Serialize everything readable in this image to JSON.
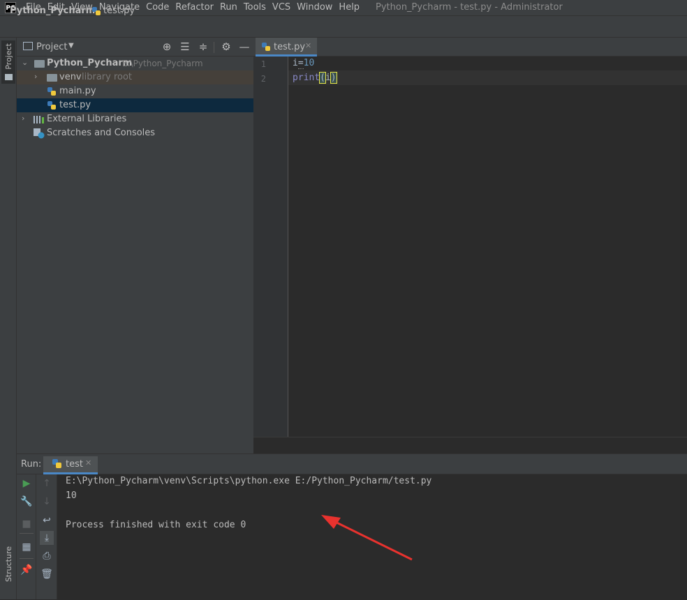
{
  "app": {
    "logo_text": "PC",
    "window_title": "Python_Pycharm - test.py - Administrator"
  },
  "menu": [
    "File",
    "Edit",
    "View",
    "Navigate",
    "Code",
    "Refactor",
    "Run",
    "Tools",
    "VCS",
    "Window",
    "Help"
  ],
  "breadcrumb": {
    "project": "Python_Pycharm",
    "file": "test.py"
  },
  "left_stripe": {
    "project": "Project",
    "structure": "Structure"
  },
  "project_panel": {
    "title": "Project",
    "tree": [
      {
        "label": "Python_Pycharm",
        "hint": "E:\\Python_Pycharm"
      },
      {
        "label": "venv",
        "hint": "library root"
      },
      {
        "label": "main.py"
      },
      {
        "label": "test.py"
      },
      {
        "label": "External Libraries"
      },
      {
        "label": "Scratches and Consoles"
      }
    ]
  },
  "editor": {
    "tab": "test.py",
    "line_numbers": [
      "1",
      "2"
    ],
    "code": {
      "l1_var": "i",
      "l1_op": "=",
      "l1_num": "10",
      "l2_fn": "print",
      "l2_open": "(",
      "l2_arg": "i",
      "l2_close": ")"
    }
  },
  "run_panel": {
    "label": "Run:",
    "tab": "test",
    "output": [
      "E:\\Python_Pycharm\\venv\\Scripts\\python.exe E:/Python_Pycharm/test.py",
      "10",
      "",
      "Process finished with exit code 0"
    ]
  },
  "colors": {
    "accent": "#4a88c7",
    "annotation_arrow": "#e8322e",
    "run_green": "#499c54"
  }
}
